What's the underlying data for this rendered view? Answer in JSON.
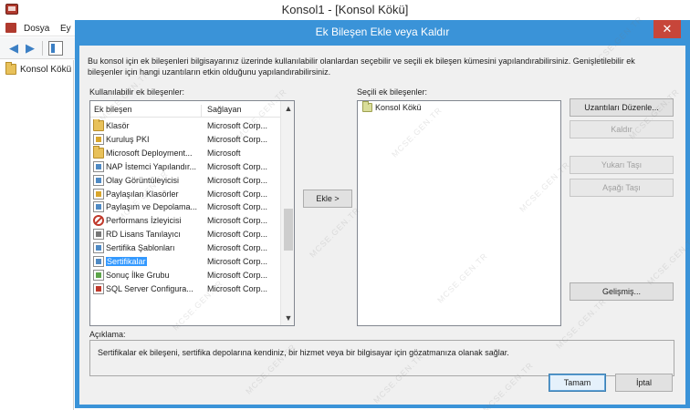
{
  "window": {
    "title": "Konsol1 - [Konsol Kökü]",
    "menu": [
      "Dosya",
      "Ey"
    ]
  },
  "tree": {
    "root_label": "Konsol Kökü"
  },
  "dialog": {
    "title": "Ek Bileşen Ekle veya Kaldır",
    "close_glyph": "✕",
    "intro": "Bu konsol için ek bileşenleri bilgisayarınız üzerinde kullanılabilir olanlardan seçebilir ve seçili ek bileşen kümesini yapılandırabilirsiniz. Genişletilebilir ek bileşenler için hangi uzantıların etkin olduğunu yapılandırabilirsiniz.",
    "available_label": "Kullanılabilir ek bileşenler:",
    "selected_label": "Seçili ek bileşenler:",
    "columns": {
      "name": "Ek bileşen",
      "provider": "Sağlayan"
    },
    "available": [
      {
        "name": "Klasör",
        "provider": "Microsoft Corp...",
        "icon": "folder-icon",
        "selected": false
      },
      {
        "name": "Kuruluş PKI",
        "provider": "Microsoft Corp...",
        "icon": "pki-icon",
        "selected": false
      },
      {
        "name": "Microsoft Deployment...",
        "provider": "Microsoft",
        "icon": "folder-icon",
        "selected": false
      },
      {
        "name": "NAP İstemci Yapılandır...",
        "provider": "Microsoft Corp...",
        "icon": "nap-icon",
        "selected": false
      },
      {
        "name": "Olay Görüntüleyicisi",
        "provider": "Microsoft Corp...",
        "icon": "event-viewer-icon",
        "selected": false
      },
      {
        "name": "Paylaşılan Klasörler",
        "provider": "Microsoft Corp...",
        "icon": "shared-folders-icon",
        "selected": false
      },
      {
        "name": "Paylaşım ve Depolama...",
        "provider": "Microsoft Corp...",
        "icon": "storage-icon",
        "selected": false
      },
      {
        "name": "Performans İzleyicisi",
        "provider": "Microsoft Corp...",
        "icon": "performance-monitor-icon",
        "selected": false
      },
      {
        "name": "RD Lisans Tanılayıcı",
        "provider": "Microsoft Corp...",
        "icon": "license-icon",
        "selected": false
      },
      {
        "name": "Sertifika Şablonları",
        "provider": "Microsoft Corp...",
        "icon": "template-icon",
        "selected": false
      },
      {
        "name": "Sertifikalar",
        "provider": "Microsoft Corp...",
        "icon": "certificate-icon",
        "selected": true
      },
      {
        "name": "Sonuç İlke Grubu",
        "provider": "Microsoft Corp...",
        "icon": "policy-icon",
        "selected": false
      },
      {
        "name": "SQL Server Configura...",
        "provider": "Microsoft Corp...",
        "icon": "sql-icon",
        "selected": false
      }
    ],
    "selected_items": [
      {
        "name": "Konsol Kökü",
        "icon": "folder-icon"
      }
    ],
    "add_button": "Ekle >",
    "buttons": {
      "extensions": "Uzantıları Düzenle...",
      "remove": "Kaldır",
      "move_up": "Yukarı Taşı",
      "move_down": "Aşağı Taşı",
      "advanced": "Gelişmiş..."
    },
    "description_label": "Açıklama:",
    "description": "Sertifikalar ek bileşeni, sertifika depolarına kendiniz, bir hizmet veya bir bilgisayar için gözatmanıza olanak sağlar.",
    "ok": "Tamam",
    "cancel": "İptal"
  },
  "watermark": "MCSE.GEN.TR"
}
